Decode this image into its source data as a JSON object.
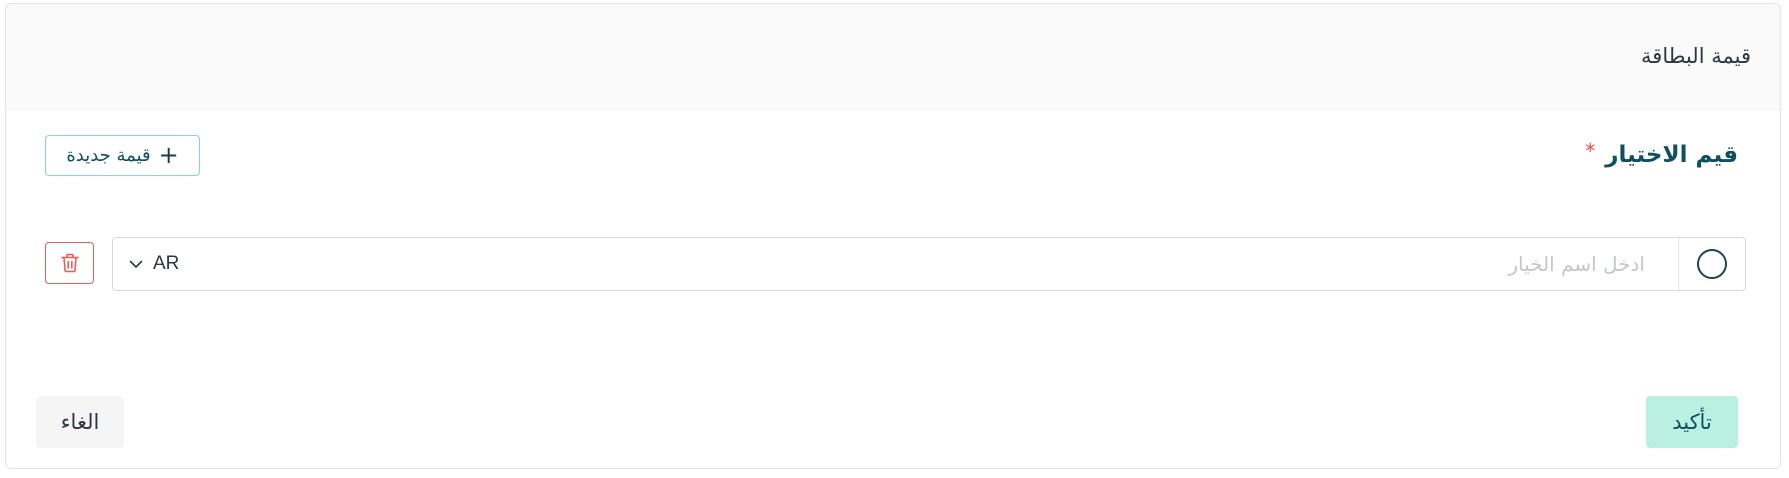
{
  "card": {
    "title": "قيمة البطاقة"
  },
  "field": {
    "label": "قيم الاختيار",
    "required_mark": "*"
  },
  "new_value_button": {
    "label": "قيمة جديدة",
    "icon": "plus-icon"
  },
  "option": {
    "name_value": "",
    "name_placeholder": "ادخل اسم الخيار",
    "language": "AR",
    "language_icon": "chevron-down-icon",
    "delete_icon": "trash-icon"
  },
  "footer": {
    "confirm_label": "تأكيد",
    "cancel_label": "الغاء"
  },
  "colors": {
    "accent": "#b9f0e2",
    "label_text": "#0f4f5e",
    "danger": "#e85c5c",
    "outline_accent": "#7fdcc6"
  }
}
